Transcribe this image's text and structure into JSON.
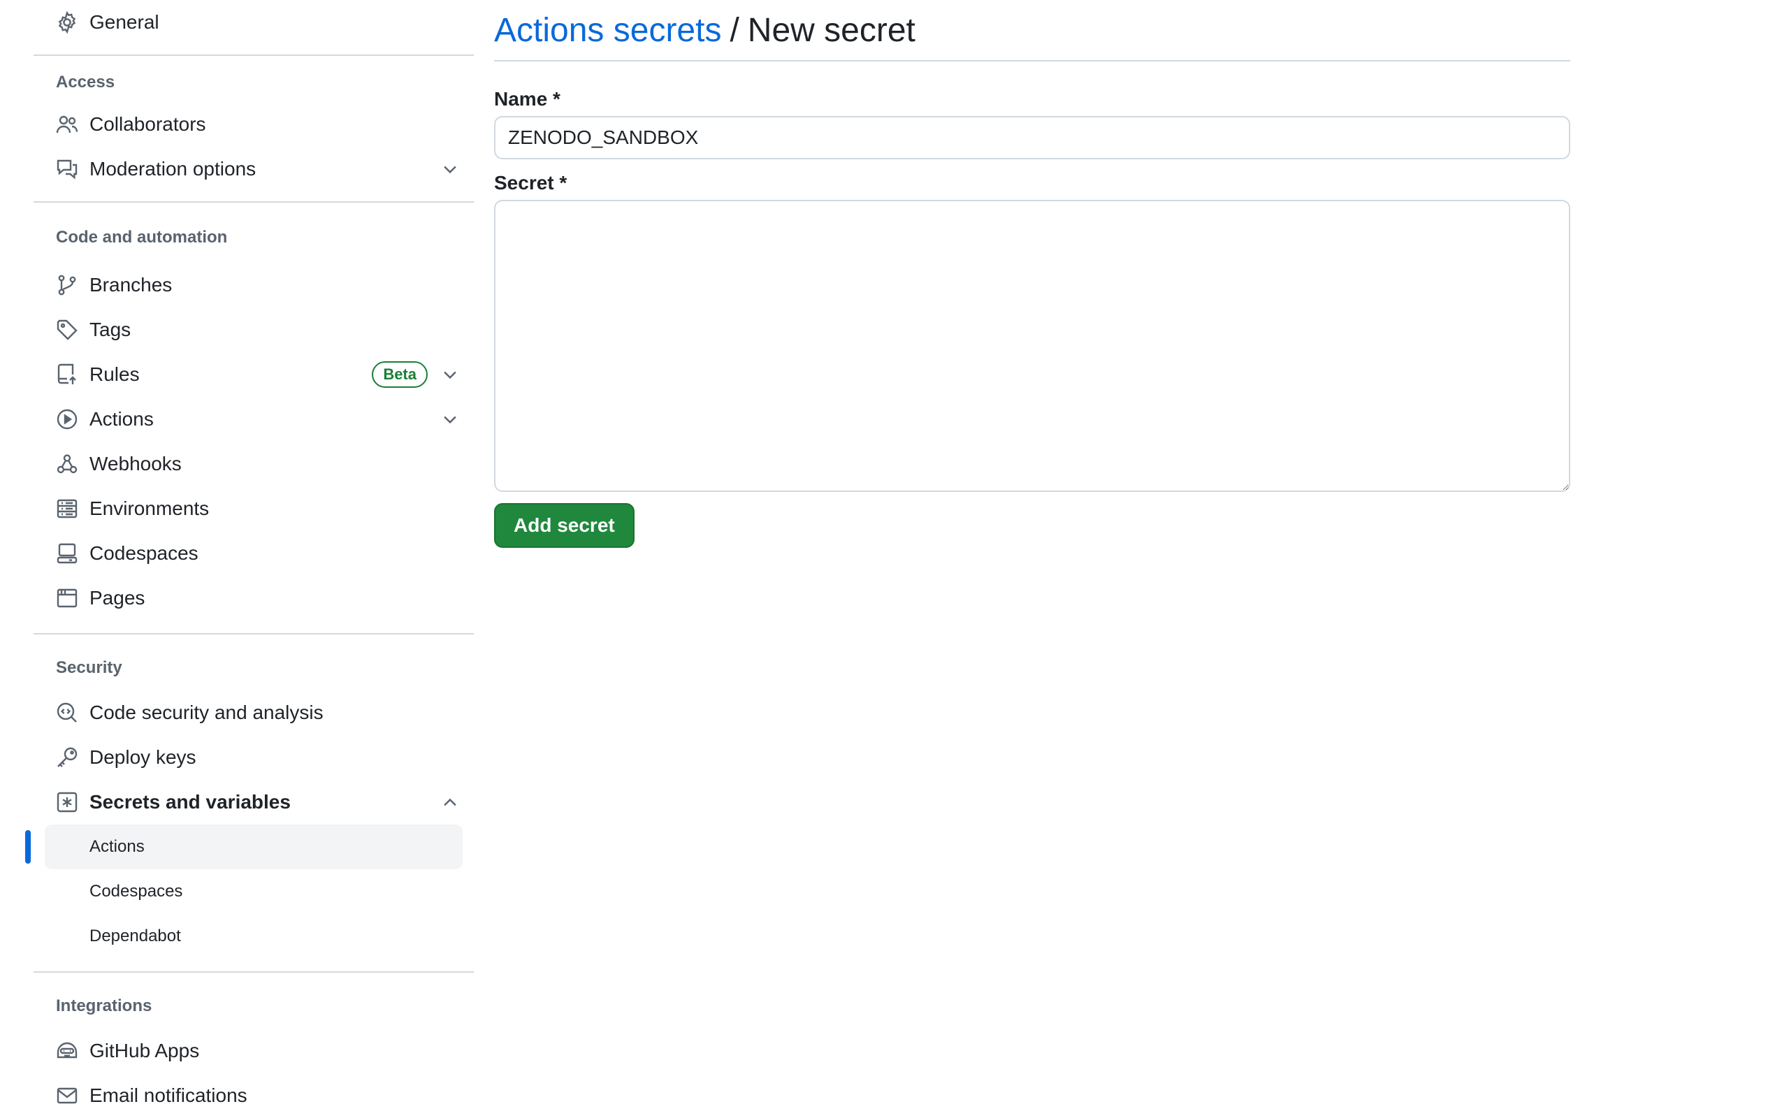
{
  "sidebar": {
    "general": {
      "label": "General",
      "icon": "gear-icon"
    },
    "sections": {
      "access": {
        "heading": "Access",
        "items": [
          {
            "label": "Collaborators",
            "icon": "people-icon"
          },
          {
            "label": "Moderation options",
            "icon": "comment-discussion-icon",
            "expandable": true
          }
        ]
      },
      "code_automation": {
        "heading": "Code and automation",
        "items": [
          {
            "label": "Branches",
            "icon": "git-branch-icon"
          },
          {
            "label": "Tags",
            "icon": "tag-icon"
          },
          {
            "label": "Rules",
            "icon": "repo-push-icon",
            "badge": "Beta",
            "expandable": true
          },
          {
            "label": "Actions",
            "icon": "play-icon",
            "expandable": true
          },
          {
            "label": "Webhooks",
            "icon": "webhook-icon"
          },
          {
            "label": "Environments",
            "icon": "server-icon"
          },
          {
            "label": "Codespaces",
            "icon": "codespaces-icon"
          },
          {
            "label": "Pages",
            "icon": "browser-icon"
          }
        ]
      },
      "security": {
        "heading": "Security",
        "items": [
          {
            "label": "Code security and analysis",
            "icon": "codescan-icon"
          },
          {
            "label": "Deploy keys",
            "icon": "key-icon"
          },
          {
            "label": "Secrets and variables",
            "icon": "key-asterisk-icon",
            "expanded": true
          }
        ],
        "sub_items": [
          {
            "label": "Actions",
            "active": true
          },
          {
            "label": "Codespaces"
          },
          {
            "label": "Dependabot"
          }
        ]
      },
      "integrations": {
        "heading": "Integrations",
        "items": [
          {
            "label": "GitHub Apps",
            "icon": "hubot-icon"
          },
          {
            "label": "Email notifications",
            "icon": "mail-icon"
          }
        ]
      }
    }
  },
  "main": {
    "breadcrumb_link": "Actions secrets",
    "breadcrumb_separator": "/",
    "title": "New secret",
    "name_label": "Name *",
    "name_value": "ZENODO_SANDBOX",
    "secret_label": "Secret *",
    "secret_value": "",
    "submit_label": "Add secret"
  },
  "colors": {
    "link": "#0969da",
    "primary_button": "#1f883d",
    "beta_badge": "#1a7f37",
    "active_indicator": "#0969da"
  }
}
